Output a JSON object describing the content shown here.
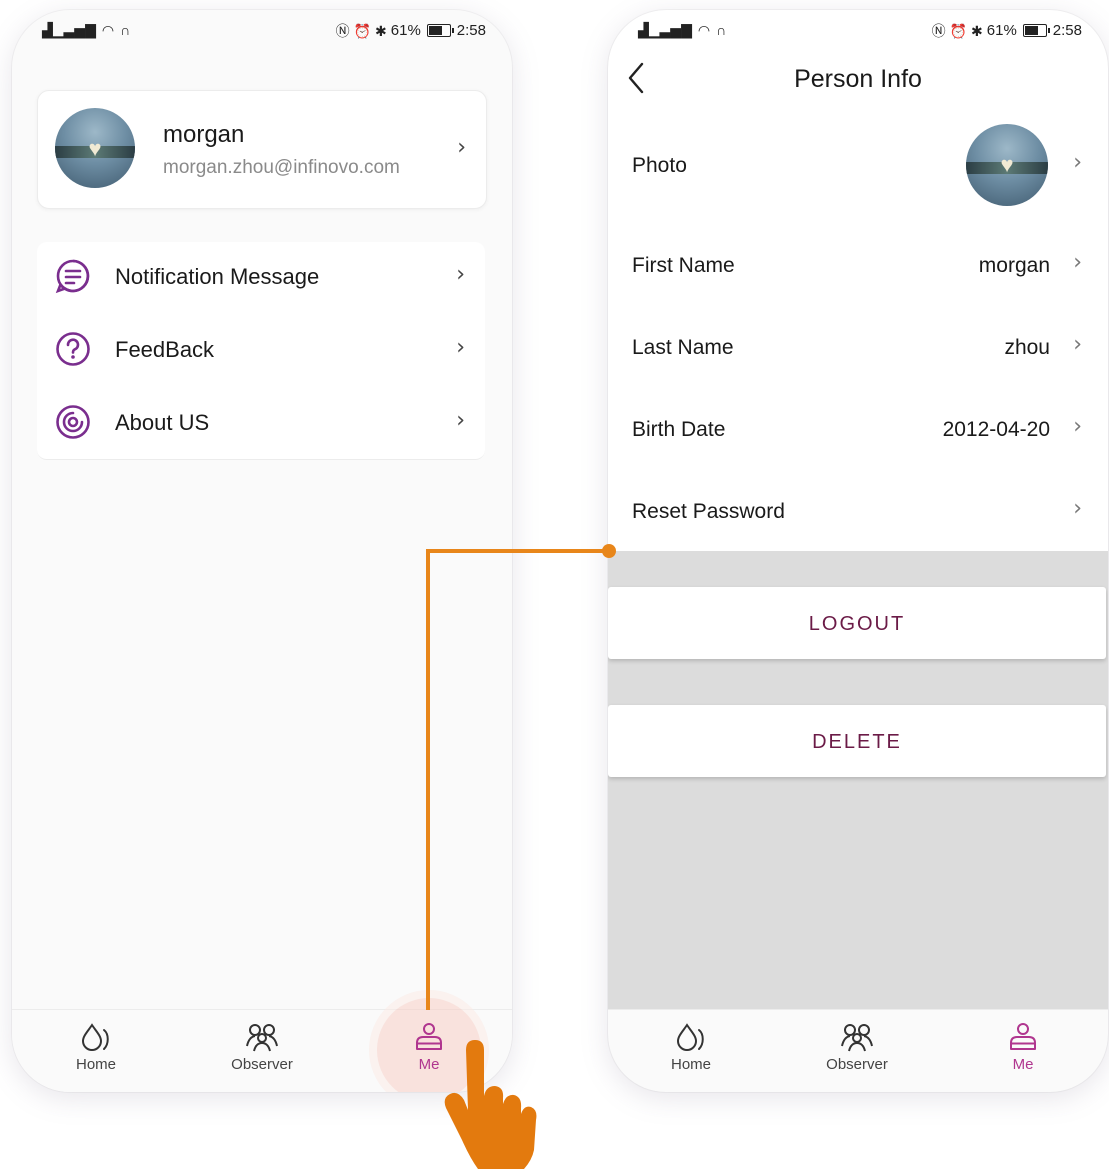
{
  "status_bar": {
    "battery": "61%",
    "time": "2:58"
  },
  "left_screen": {
    "profile": {
      "name": "morgan",
      "email": "morgan.zhou@infinovo.com"
    },
    "menu": [
      {
        "label": "Notification Message",
        "icon": "message-icon"
      },
      {
        "label": "FeedBack",
        "icon": "question-icon"
      },
      {
        "label": "About US",
        "icon": "about-icon"
      }
    ]
  },
  "right_screen": {
    "title": "Person Info",
    "rows": [
      {
        "label": "Photo",
        "value": ""
      },
      {
        "label": "First Name",
        "value": "morgan"
      },
      {
        "label": "Last Name",
        "value": "zhou"
      },
      {
        "label": "Birth Date",
        "value": "2012-04-20"
      },
      {
        "label": "Reset Password",
        "value": ""
      }
    ],
    "logout_label": "LOGOUT",
    "delete_label": "DELETE"
  },
  "tabbar": {
    "tabs": [
      {
        "label": "Home",
        "icon": "drop-icon"
      },
      {
        "label": "Observer",
        "icon": "people-icon"
      },
      {
        "label": "Me",
        "icon": "person-icon"
      }
    ],
    "active": "Me"
  },
  "colors": {
    "accent": "#b0368f",
    "button_text": "#6b1b47",
    "connector": "#e8861a",
    "highlight": "#f7cec4"
  }
}
